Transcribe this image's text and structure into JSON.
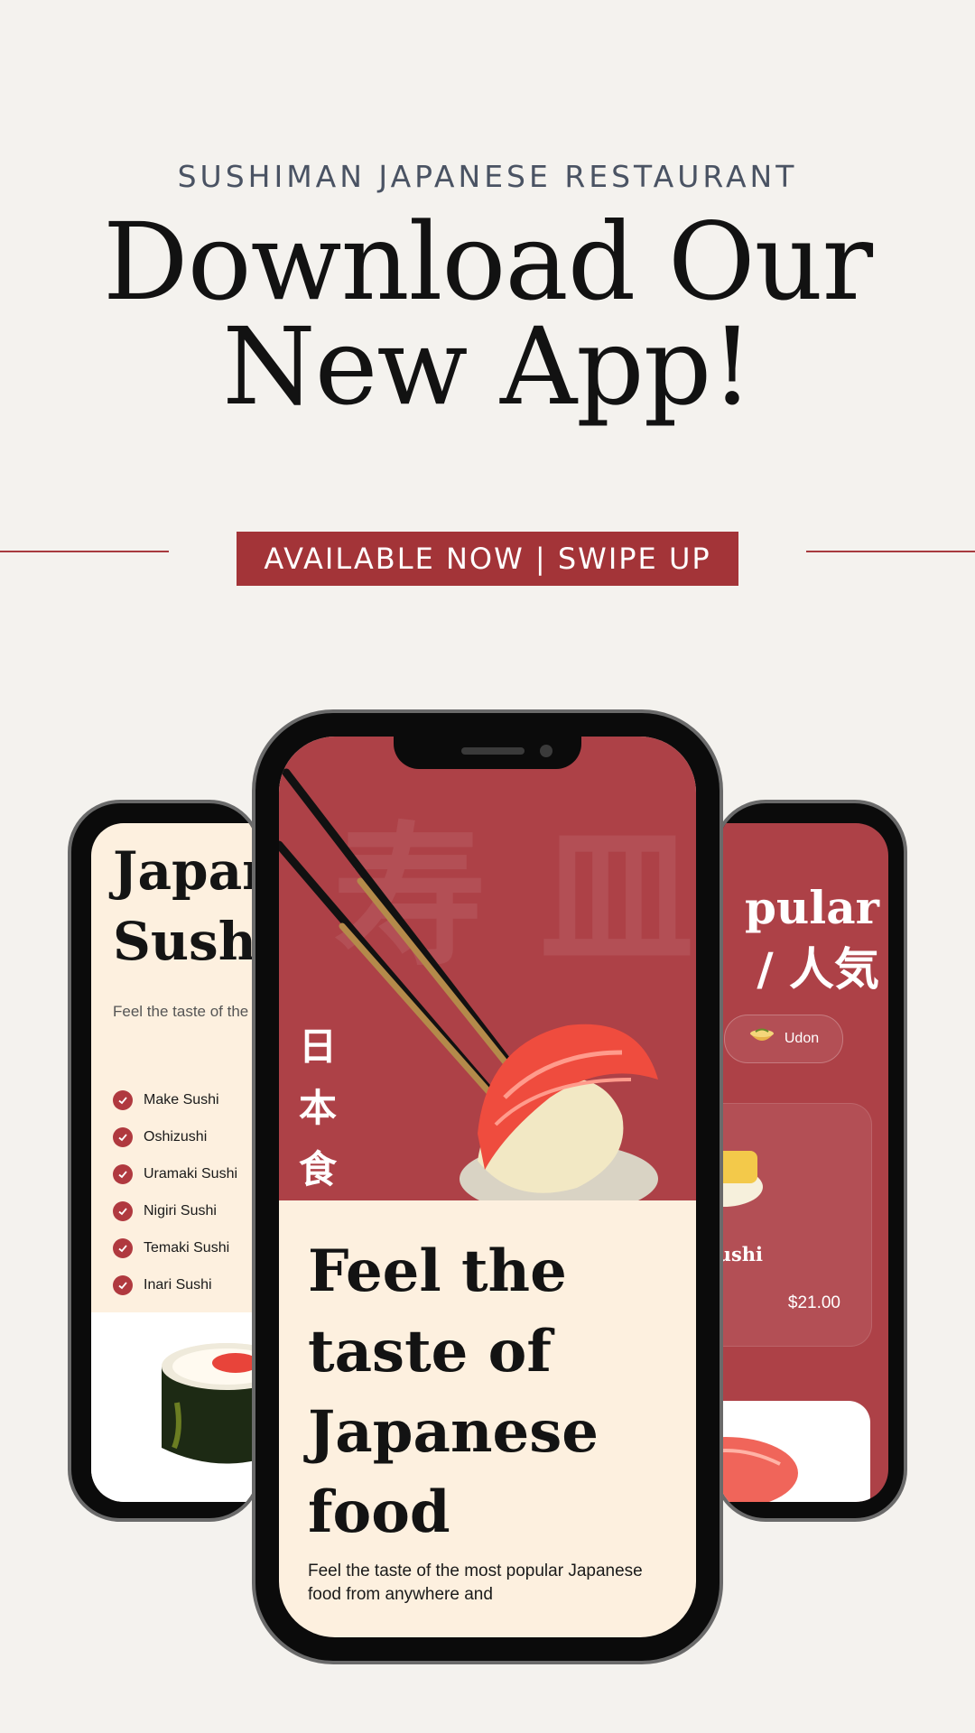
{
  "header": {
    "kicker": "SUSHIMAN JAPANESE RESTAURANT",
    "headline_line1": "Download Our",
    "headline_line2": "New App!",
    "cta": "AVAILABLE NOW | SWIPE UP"
  },
  "left_phone": {
    "title": "Japan\nSushi",
    "description": "Feel the taste of the here.",
    "list": [
      "Make Sushi",
      "Oshizushi",
      "Uramaki Sushi",
      "Nigiri Sushi",
      "Temaki Sushi",
      "Inari Sushi"
    ]
  },
  "center_phone": {
    "vertical_kanji": [
      "日",
      "本",
      "食"
    ],
    "heading": "Feel the taste of Japanese food",
    "body": "Feel the taste of the most popular Japanese food from anywhere and"
  },
  "right_phone": {
    "title": "pular\n/ 人気",
    "chip": "Udon",
    "card_name": "zu Sushi",
    "card_price": "$21.00"
  },
  "colors": {
    "accent": "#a33438",
    "screen_red": "#ad4147",
    "cream": "#fdf0df",
    "background": "#f4f2ee"
  }
}
